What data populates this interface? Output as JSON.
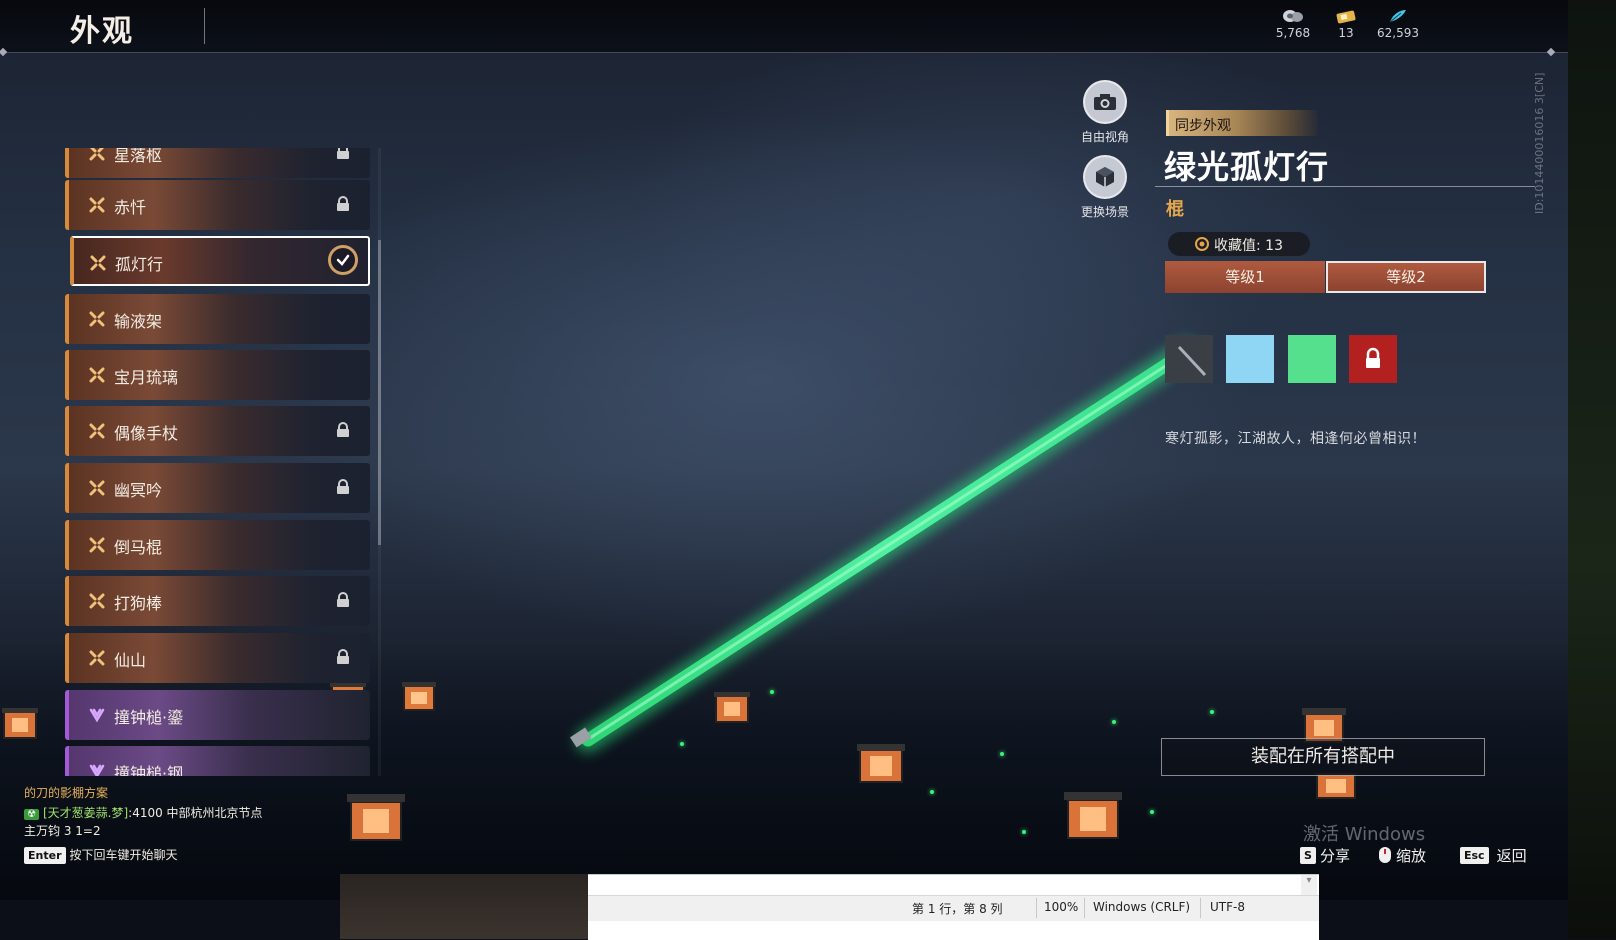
{
  "header": {
    "title": "外观",
    "currencies": [
      {
        "icon": "coin-icon",
        "value": "5,768"
      },
      {
        "icon": "ticket-icon",
        "value": "13"
      },
      {
        "icon": "feather-icon",
        "value": "62,593"
      }
    ]
  },
  "list": {
    "items": [
      {
        "label": "星落枢",
        "locked": true,
        "rarity": "orange"
      },
      {
        "label": "赤忏",
        "locked": true,
        "rarity": "orange"
      },
      {
        "label": "孤灯行",
        "locked": false,
        "selected": true,
        "rarity": "orange"
      },
      {
        "label": "输液架",
        "locked": false,
        "rarity": "orange"
      },
      {
        "label": "宝月琉璃",
        "locked": false,
        "rarity": "orange"
      },
      {
        "label": "偶像手杖",
        "locked": true,
        "rarity": "orange"
      },
      {
        "label": "幽冥吟",
        "locked": true,
        "rarity": "orange"
      },
      {
        "label": "倒马棍",
        "locked": false,
        "rarity": "orange"
      },
      {
        "label": "打狗棒",
        "locked": true,
        "rarity": "orange"
      },
      {
        "label": "仙山",
        "locked": true,
        "rarity": "orange"
      },
      {
        "label": "撞钟槌·鎏",
        "locked": false,
        "rarity": "purple"
      },
      {
        "label": "撞钟槌·钢",
        "locked": false,
        "rarity": "purple"
      }
    ]
  },
  "camera": {
    "free_view": "自由视角",
    "change_scene": "更换场景"
  },
  "detail": {
    "sync_label": "同步外观",
    "name": "绿光孤灯行",
    "category": "棍",
    "collect_label": "收藏值: 13",
    "tiers": [
      "等级1",
      "等级2"
    ],
    "active_tier": 1,
    "swatch_colors": [
      "#3a3e45",
      "#8fd6f5",
      "#54e08c",
      "#b2211f"
    ],
    "description": "寒灯孤影，江湖故人，相逢何必曾相识！",
    "equip_button": "装配在所有搭配中",
    "id_text": "ID:1014400016016 3[CN]"
  },
  "hints": {
    "share_key": "S",
    "share": "分享",
    "zoom": "缩放",
    "back_key": "Esc",
    "back": "返回",
    "watermark": "激活 Windows"
  },
  "chat": {
    "line1": "的刀的影棚方案",
    "player": "[天才葱姜蒜.梦]",
    "line2_rest": ":4100 中部杭州北京节点",
    "line3": "主万钧  3  1=2",
    "enter_key": "Enter",
    "enter_hint": "按下回车键开始聊天"
  },
  "notepad": {
    "position": "第 1 行，第 8 列",
    "zoom": "100%",
    "eol": "Windows (CRLF)",
    "encoding": "UTF-8"
  }
}
